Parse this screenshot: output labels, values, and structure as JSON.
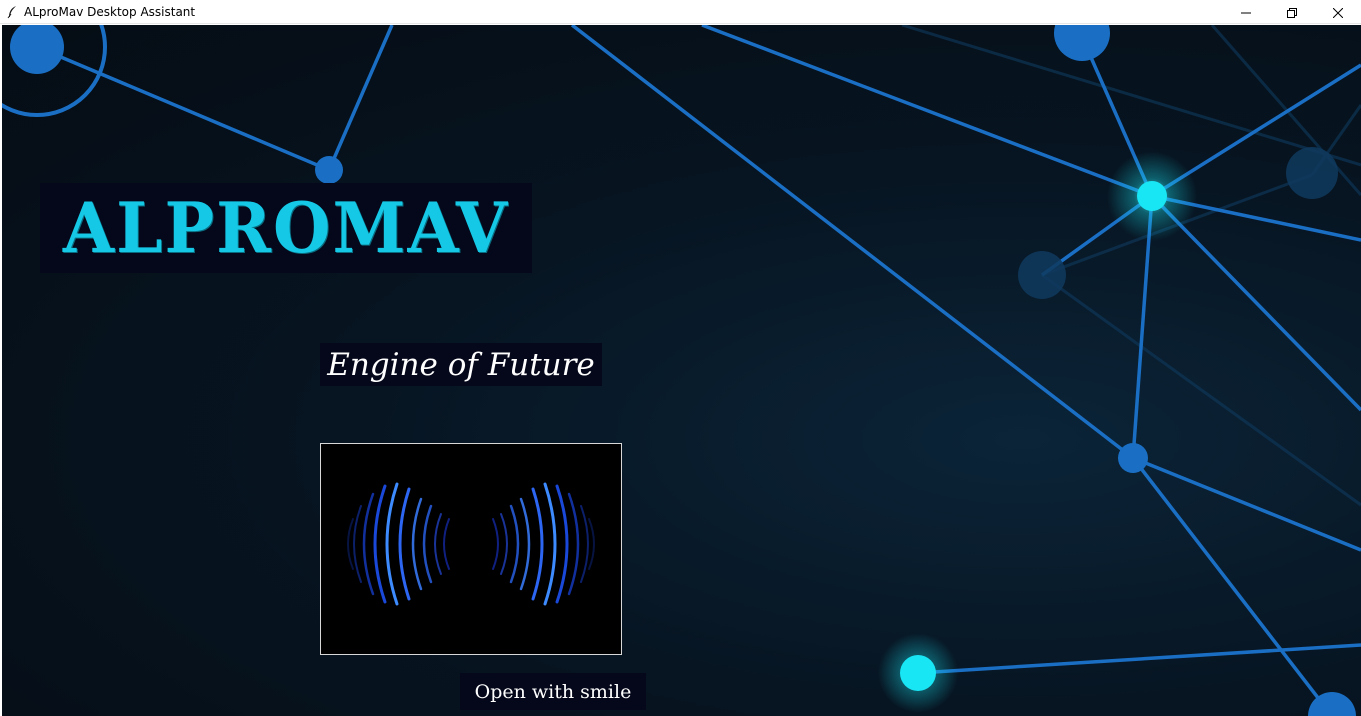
{
  "window": {
    "title": "ALproMav Desktop Assistant",
    "app_icon": "feather-icon",
    "controls": [
      "minimize-icon",
      "restore-icon",
      "close-icon"
    ]
  },
  "main": {
    "logo": "ALPROMAV",
    "tagline": "Engine of Future",
    "voice_visual": "sound-wave-icon",
    "action_button": "Open with smile"
  },
  "colors": {
    "logo": "#14c8e6",
    "panel": "#05081a",
    "network_line": "#1a74c8",
    "glow_node": "#19e6f5"
  }
}
